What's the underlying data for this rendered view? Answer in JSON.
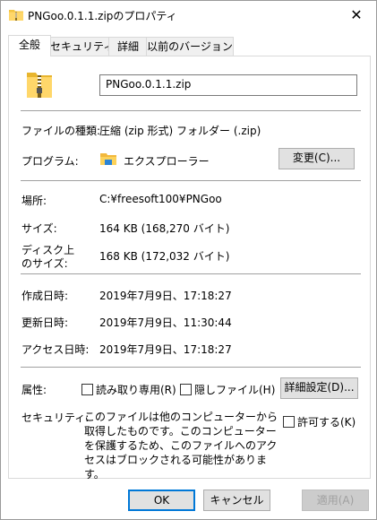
{
  "window": {
    "title": "PNGoo.0.1.1.zipのプロパティ",
    "close_label": "✕"
  },
  "tabs": [
    {
      "label": "全般"
    },
    {
      "label": "セキュリティ"
    },
    {
      "label": "詳細"
    },
    {
      "label": "以前のバージョン"
    }
  ],
  "general": {
    "file_name": "PNGoo.0.1.1.zip",
    "file_type_label": "ファイルの種類:",
    "file_type_value": "圧縮 (zip 形式) フォルダー (.zip)",
    "program_label": "プログラム:",
    "program_value": "エクスプローラー",
    "change_button": "変更(C)...",
    "location_label": "場所:",
    "location_value": "C:¥freesoft100¥PNGoo",
    "size_label": "サイズ:",
    "size_value": "164 KB (168,270 バイト)",
    "size_on_disk_label_1": "ディスク上",
    "size_on_disk_label_2": "のサイズ:",
    "size_on_disk_value": "168 KB (172,032 バイト)",
    "created_label": "作成日時:",
    "created_value": "2019年7月9日、17:18:27",
    "modified_label": "更新日時:",
    "modified_value": "2019年7月9日、11:30:44",
    "accessed_label": "アクセス日時:",
    "accessed_value": "2019年7月9日、17:18:27",
    "attributes_label": "属性:",
    "readonly_label": "読み取り専用(R)",
    "hidden_label": "隠しファイル(H)",
    "advanced_button": "詳細設定(D)...",
    "security_label": "セキュリティ:",
    "security_text": "このファイルは他のコンピューターから取得したものです。このコンピューターを保護するため、このファイルへのアクセスはブロックされる可能性があります。",
    "unblock_label": "許可する(K)"
  },
  "footer": {
    "ok": "OK",
    "cancel": "キャンセル",
    "apply": "適用(A)"
  },
  "colors": {
    "folder_yellow": "#f4c542",
    "accent": "#0078d7"
  }
}
